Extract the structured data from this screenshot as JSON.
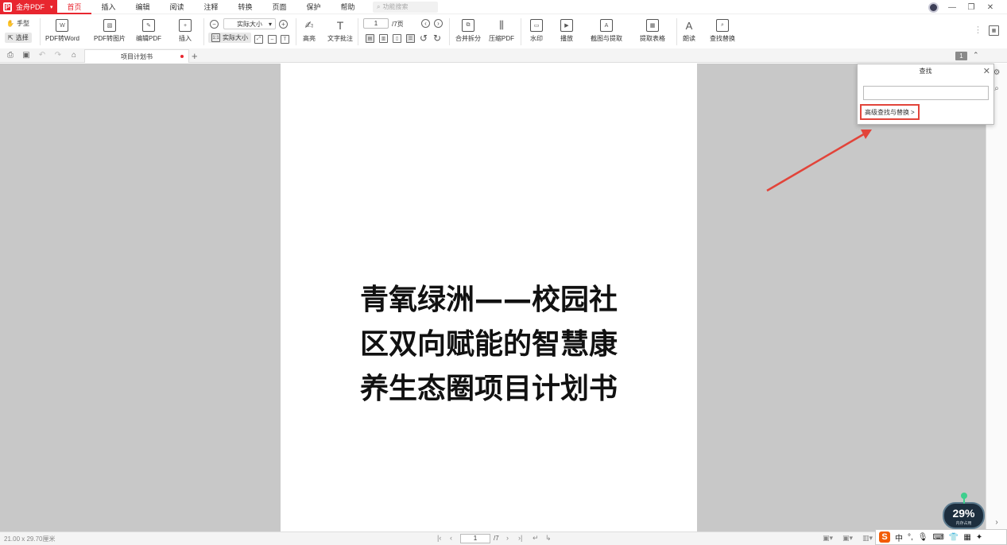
{
  "app": {
    "brand_name": "金舟PDF",
    "brand_logo": "P",
    "accent": "#e8262f"
  },
  "menu": {
    "items": [
      "首页",
      "插入",
      "编辑",
      "阅读",
      "注释",
      "转换",
      "页面",
      "保护",
      "帮助"
    ],
    "active": "首页",
    "search_placeholder": "功能搜索"
  },
  "ribbon": {
    "hand": "手型",
    "select": "选择",
    "pdf_to_word": "PDF转Word",
    "pdf_to_image": "PDF转图片",
    "edit_pdf": "编辑PDF",
    "insert": "插入",
    "zoom_value": "实际大小",
    "actual_size": "实际大小",
    "highlight": "高亮",
    "text_comment": "文字批注",
    "page_current": "1",
    "page_total": "/7页",
    "merge_split": "合并拆分",
    "compress": "压缩PDF",
    "watermark": "水印",
    "play": "播放",
    "screenshot_extract": "截图与提取",
    "extract_table": "提取表格",
    "read_aloud": "朗读",
    "find_replace": "查找替换"
  },
  "tabs": {
    "doc_tab": "项目计划书",
    "page_badge": "1"
  },
  "document": {
    "title_lines": [
      "青氧绿洲——校园社",
      "区双向赋能的智慧康",
      "养生态圈项目计划书"
    ]
  },
  "find_panel": {
    "title": "查找",
    "input_value": "",
    "advanced_link": "高级查找与替换",
    "highlight_color": "#e2443a"
  },
  "statusbar": {
    "dimensions": "21.00 x 29.70厘米",
    "page_current": "1",
    "page_total": "/7"
  },
  "widget": {
    "progress_text": "29%",
    "progress_label": "内存占用",
    "progress_value": 0.29
  },
  "ime": {
    "lang": "中"
  }
}
